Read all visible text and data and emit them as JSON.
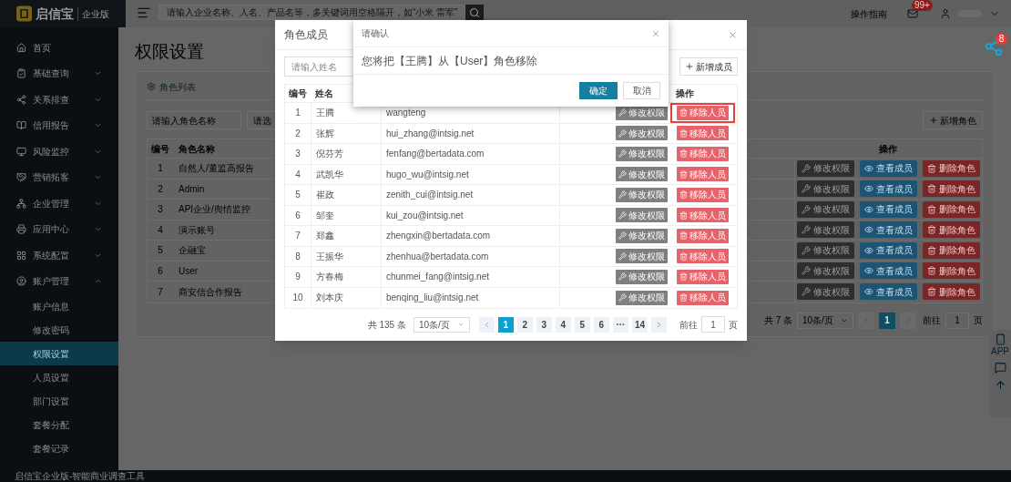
{
  "header": {
    "search_placeholder": "请输入企业名称、人名、产品名等，多关键词用空格隔开，如“小米 雷军”",
    "guide": "操作指南",
    "mail_badge": "99+"
  },
  "sidebar": {
    "logo_text": "启信宝",
    "logo_edition": "企业版",
    "items": [
      {
        "label": "首页"
      },
      {
        "label": "基础查询",
        "expanded": false
      },
      {
        "label": "关系排查",
        "expanded": false
      },
      {
        "label": "信用报告",
        "expanded": false
      },
      {
        "label": "风险监控",
        "expanded": false
      },
      {
        "label": "营销拓客",
        "expanded": false
      },
      {
        "label": "企业管理",
        "expanded": false
      },
      {
        "label": "应用中心",
        "expanded": false
      },
      {
        "label": "系统配置",
        "expanded": false
      },
      {
        "label": "账户管理",
        "expanded": true,
        "children": [
          {
            "label": "账户信息",
            "selected": false
          },
          {
            "label": "修改密码",
            "selected": false
          },
          {
            "label": "权限设置",
            "selected": true
          },
          {
            "label": "人员设置",
            "selected": false
          },
          {
            "label": "部门设置",
            "selected": false
          },
          {
            "label": "套餐分配",
            "selected": false
          },
          {
            "label": "套餐记录",
            "selected": false
          }
        ]
      }
    ]
  },
  "page": {
    "title": "权限设置",
    "card_title": "角色列表",
    "name_placeholder": "请输入角色名称",
    "select_placeholder": "请选",
    "add_button": "新增角色",
    "columns": [
      "编号",
      "角色名称",
      "操作"
    ],
    "rows": [
      {
        "no": "1",
        "name": "自然人/董监高报告",
        "actions": [
          {
            "kind": "edit",
            "label": "修改权限"
          },
          {
            "kind": "view",
            "label": "查看成员"
          },
          {
            "kind": "delete",
            "label": "删除角色"
          }
        ]
      },
      {
        "no": "2",
        "name": "Admin",
        "actions": [
          {
            "kind": "edit",
            "label": "修改权限"
          },
          {
            "kind": "view",
            "label": "查看成员"
          },
          {
            "kind": "delete",
            "label": "删除角色"
          }
        ]
      },
      {
        "no": "3",
        "name": "API企业/舆情监控",
        "actions": [
          {
            "kind": "edit",
            "label": "修改权限"
          },
          {
            "kind": "view",
            "label": "查看成员"
          },
          {
            "kind": "delete",
            "label": "删除角色"
          }
        ]
      },
      {
        "no": "4",
        "name": "演示账号",
        "actions": [
          {
            "kind": "edit",
            "label": "修改权限"
          },
          {
            "kind": "view",
            "label": "查看成员"
          },
          {
            "kind": "delete",
            "label": "删除角色"
          }
        ]
      },
      {
        "no": "5",
        "name": "企融宝",
        "actions": [
          {
            "kind": "edit",
            "label": "修改权限"
          },
          {
            "kind": "view",
            "label": "查看成员"
          },
          {
            "kind": "delete",
            "label": "删除角色"
          }
        ]
      },
      {
        "no": "6",
        "name": "User",
        "actions": [
          {
            "kind": "edit",
            "label": "修改权限"
          },
          {
            "kind": "view",
            "label": "查看成员"
          },
          {
            "kind": "delete",
            "label": "删除角色"
          }
        ]
      },
      {
        "no": "7",
        "name": "商安信合作报告",
        "actions": [
          {
            "kind": "edit",
            "label": "修改权限"
          },
          {
            "kind": "view",
            "label": "查看成员"
          },
          {
            "kind": "delete",
            "label": "删除角色"
          }
        ]
      }
    ],
    "pagination": {
      "total": "共 7 条",
      "page_size": "10条/页",
      "pages": [
        {
          "label": "1",
          "selected": true
        }
      ],
      "goto_label": "前往",
      "goto_value": "1",
      "goto_unit": "页"
    }
  },
  "share_badge": "8",
  "side_tools": {
    "app_label": "APP"
  },
  "footer": "启信宝企业版-智能商业调查工具",
  "member_modal": {
    "title": "角色成员",
    "search_placeholder": "请输入姓名",
    "add_button": "新增成员",
    "columns": [
      "编号",
      "姓名",
      "操作"
    ],
    "rows": [
      {
        "no": "1",
        "name": "王腾",
        "account": "wangteng",
        "highlighted": true,
        "actions": [
          {
            "kind": "edit",
            "label": "修改权限"
          },
          {
            "kind": "remove",
            "label": "移除人员"
          }
        ]
      },
      {
        "no": "2",
        "name": "张辉",
        "account": "hui_zhang@intsig.net",
        "highlighted": false,
        "actions": [
          {
            "kind": "edit",
            "label": "修改权限"
          },
          {
            "kind": "remove",
            "label": "移除人员"
          }
        ]
      },
      {
        "no": "3",
        "name": "倪芬芳",
        "account": "fenfang@bertadata.com",
        "highlighted": false,
        "actions": [
          {
            "kind": "edit",
            "label": "修改权限"
          },
          {
            "kind": "remove",
            "label": "移除人员"
          }
        ]
      },
      {
        "no": "4",
        "name": "武凯华",
        "account": "hugo_wu@intsig.net",
        "highlighted": false,
        "actions": [
          {
            "kind": "edit",
            "label": "修改权限"
          },
          {
            "kind": "remove",
            "label": "移除人员"
          }
        ]
      },
      {
        "no": "5",
        "name": "崔政",
        "account": "zenith_cui@intsig.net",
        "highlighted": false,
        "actions": [
          {
            "kind": "edit",
            "label": "修改权限"
          },
          {
            "kind": "remove",
            "label": "移除人员"
          }
        ]
      },
      {
        "no": "6",
        "name": "邹奎",
        "account": "kui_zou@intsig.net",
        "highlighted": false,
        "actions": [
          {
            "kind": "edit",
            "label": "修改权限"
          },
          {
            "kind": "remove",
            "label": "移除人员"
          }
        ]
      },
      {
        "no": "7",
        "name": "郑鑫",
        "account": "zhengxin@bertadata.com",
        "highlighted": false,
        "actions": [
          {
            "kind": "edit",
            "label": "修改权限"
          },
          {
            "kind": "remove",
            "label": "移除人员"
          }
        ]
      },
      {
        "no": "8",
        "name": "王振华",
        "account": "zhenhua@bertadata.com",
        "highlighted": false,
        "actions": [
          {
            "kind": "edit",
            "label": "修改权限"
          },
          {
            "kind": "remove",
            "label": "移除人员"
          }
        ]
      },
      {
        "no": "9",
        "name": "方春梅",
        "account": "chunmei_fang@intsig.net",
        "highlighted": false,
        "actions": [
          {
            "kind": "edit",
            "label": "修改权限"
          },
          {
            "kind": "remove",
            "label": "移除人员"
          }
        ]
      },
      {
        "no": "10",
        "name": "刘本庆",
        "account": "benqing_liu@intsig.net",
        "highlighted": false,
        "actions": [
          {
            "kind": "edit",
            "label": "修改权限"
          },
          {
            "kind": "remove",
            "label": "移除人员"
          }
        ]
      }
    ],
    "pagination": {
      "total": "共 135 条",
      "page_size": "10条/页",
      "pages": [
        {
          "label": "1",
          "selected": true
        },
        {
          "label": "2",
          "selected": false
        },
        {
          "label": "3",
          "selected": false
        },
        {
          "label": "4",
          "selected": false
        },
        {
          "label": "5",
          "selected": false
        },
        {
          "label": "6",
          "selected": false
        },
        {
          "label": "···",
          "selected": false
        },
        {
          "label": "14",
          "selected": false
        }
      ],
      "goto_label": "前往",
      "goto_value": "1",
      "goto_unit": "页"
    }
  },
  "confirm_dialog": {
    "title": "请确认",
    "message": "您将把【王腾】从【User】角色移除",
    "confirm": "确定",
    "cancel": "取消"
  }
}
